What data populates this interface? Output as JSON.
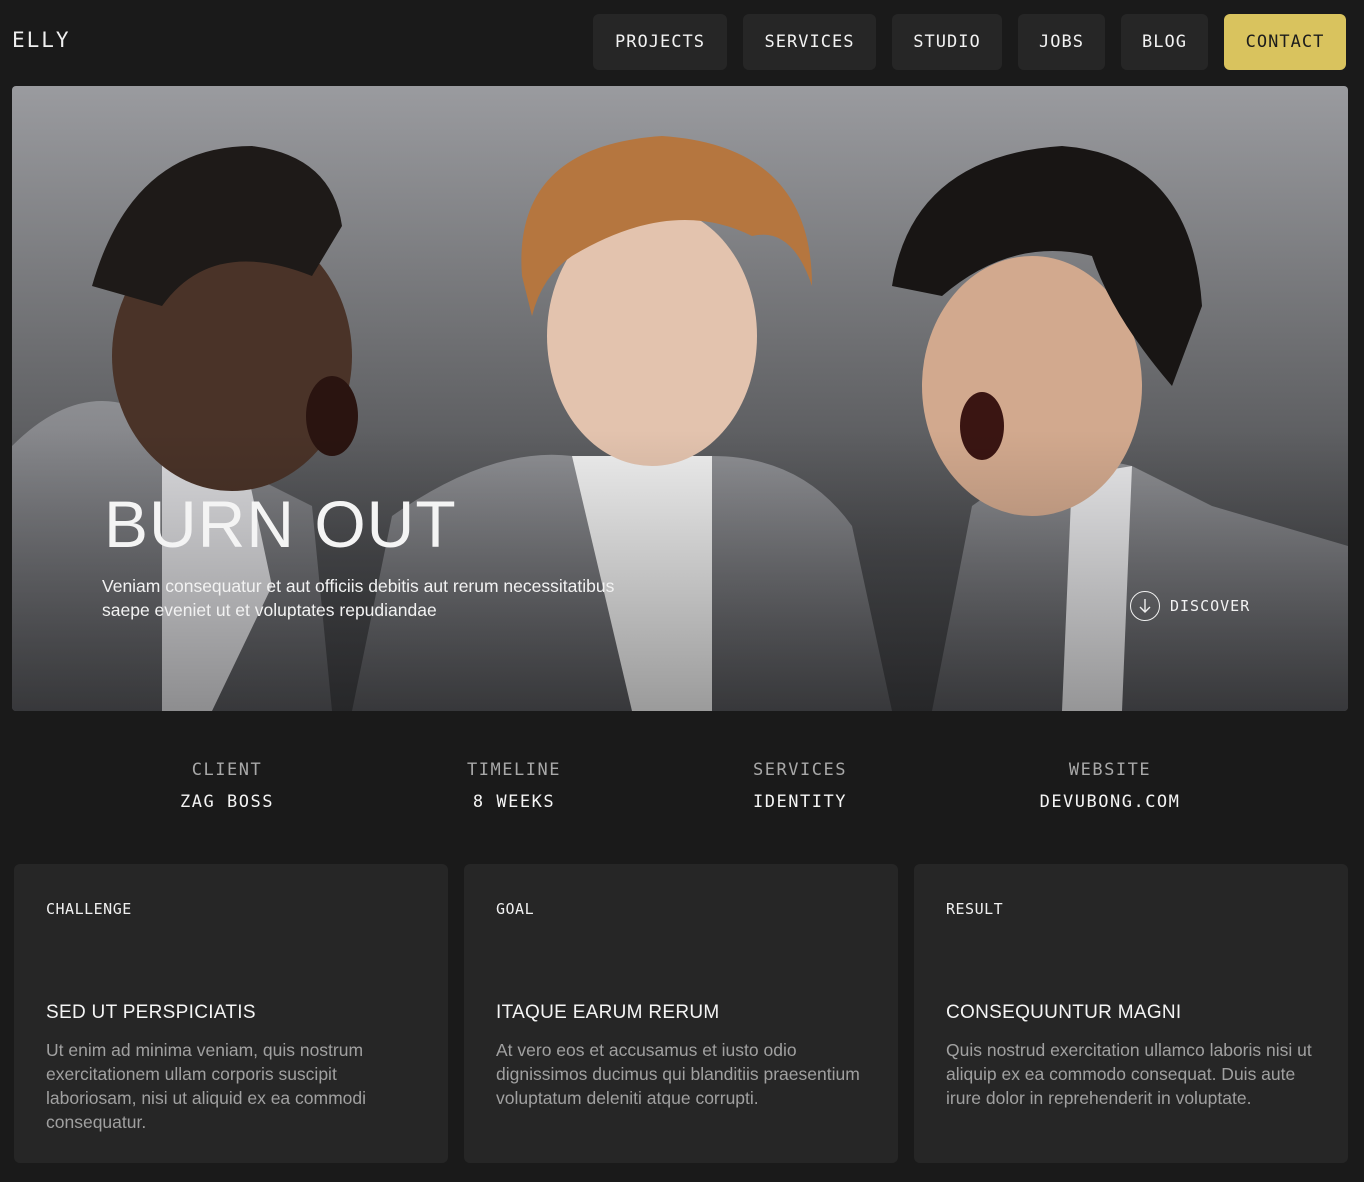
{
  "header": {
    "logo": "ELLY",
    "nav": [
      {
        "label": "PROJECTS"
      },
      {
        "label": "SERVICES"
      },
      {
        "label": "STUDIO"
      },
      {
        "label": "JOBS"
      },
      {
        "label": "BLOG"
      },
      {
        "label": "CONTACT"
      }
    ],
    "accent_color": "#d9c35e"
  },
  "hero": {
    "title": "BURN OUT",
    "subtitle": "Veniam consequatur et aut officiis debitis aut rerum necessitatibus saepe eveniet ut et voluptates repudiandae",
    "discover_label": "DISCOVER",
    "discover_icon": "arrow-down-circle-icon"
  },
  "meta": [
    {
      "label": "CLIENT",
      "value": "ZAG BOSS"
    },
    {
      "label": "TIMELINE",
      "value": "8 WEEKS"
    },
    {
      "label": "SERVICES",
      "value": "IDENTITY"
    },
    {
      "label": "WEBSITE",
      "value": "DEVUBONG.COM"
    }
  ],
  "cards": [
    {
      "tag": "CHALLENGE",
      "heading": "SED UT PERSPICIATIS",
      "body": "Ut enim ad minima veniam, quis nostrum exercitationem ullam corporis suscipit laboriosam, nisi ut aliquid ex ea commodi consequatur."
    },
    {
      "tag": "GOAL",
      "heading": "ITAQUE EARUM RERUM",
      "body": "At vero eos et accusamus et iusto odio dignissimos ducimus qui blanditiis praesentium voluptatum deleniti atque corrupti."
    },
    {
      "tag": "RESULT",
      "heading": "CONSEQUUNTUR MAGNI",
      "body": "Quis nostrud exercitation ullamco laboris nisi ut aliquip ex ea commodo consequat. Duis aute irure dolor in reprehenderit in voluptate."
    }
  ]
}
